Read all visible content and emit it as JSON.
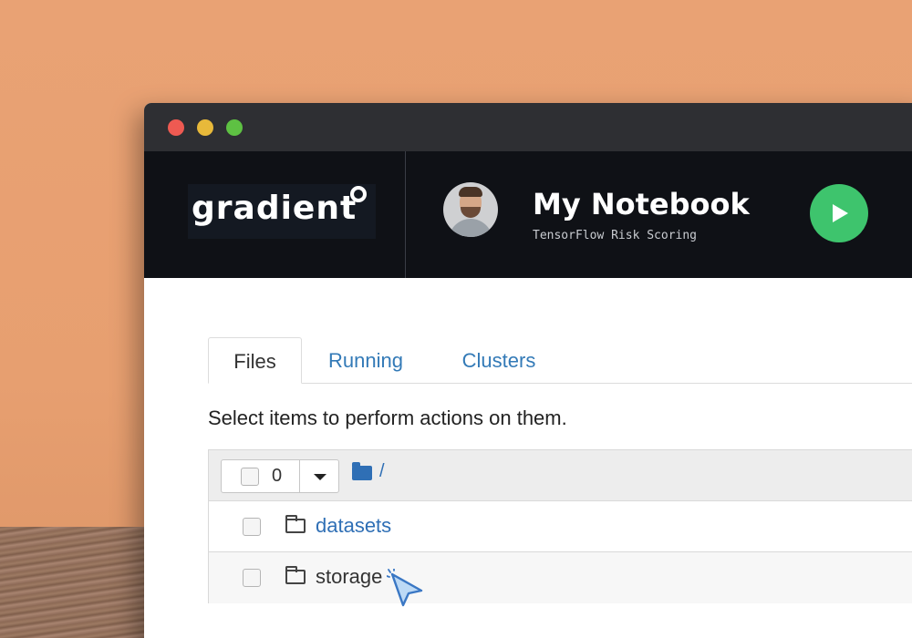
{
  "window": {
    "controls": [
      "close",
      "minimize",
      "maximize"
    ]
  },
  "header": {
    "logo_text": "gradient",
    "notebook_title": "My Notebook",
    "notebook_subtitle": "TensorFlow Risk Scoring",
    "run_icon": "play-icon",
    "run_color": "#3ec46d",
    "background": "#0f1116"
  },
  "tabs": [
    {
      "label": "Files",
      "active": true
    },
    {
      "label": "Running",
      "active": false
    },
    {
      "label": "Clusters",
      "active": false
    }
  ],
  "help_text": "Select items to perform actions on them.",
  "file_list": {
    "selected_count": "0",
    "path": "/",
    "items": [
      {
        "name": "datasets",
        "type": "folder",
        "icon": "folder-icon"
      },
      {
        "name": "storage",
        "type": "folder",
        "icon": "folder-icon"
      }
    ]
  },
  "colors": {
    "link": "#337ab7",
    "folder_icon": "#2f6fb5",
    "background": "#e9a274"
  }
}
